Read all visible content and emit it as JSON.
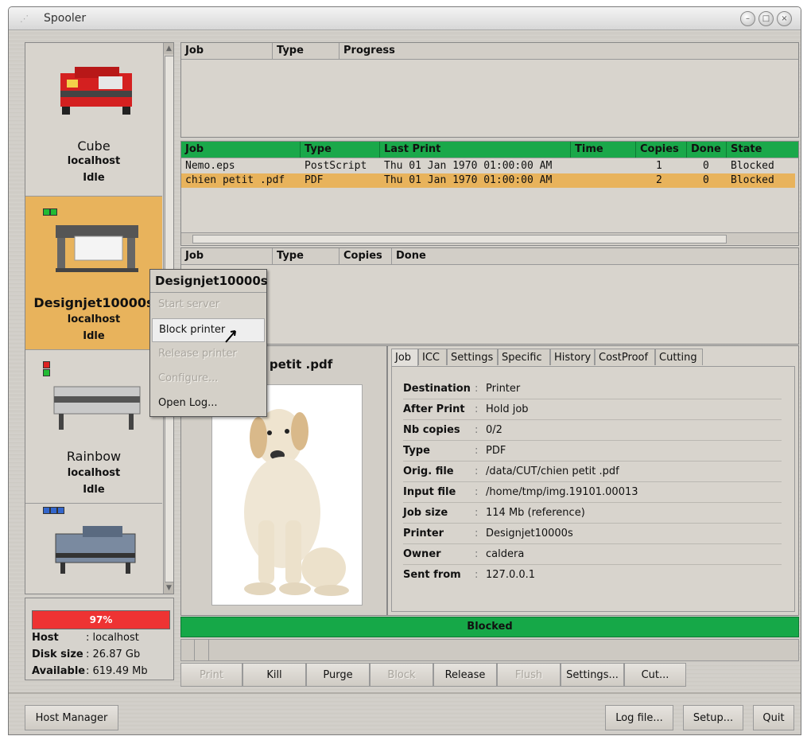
{
  "window": {
    "title": "Spooler"
  },
  "printers": [
    {
      "name": "Cube",
      "host": "localhost",
      "state": "Idle",
      "selected": false
    },
    {
      "name": "Designjet10000s",
      "host": "localhost",
      "state": "Idle",
      "selected": true
    },
    {
      "name": "Rainbow",
      "host": "localhost",
      "state": "Idle",
      "selected": false
    },
    {
      "name": "",
      "host": "",
      "state": "",
      "selected": false
    }
  ],
  "disk": {
    "usage_label": "97%",
    "usage_value": 0.97,
    "rows": [
      {
        "key": "Host",
        "value": "localhost"
      },
      {
        "key": "Disk size",
        "value": "26.87 Gb"
      },
      {
        "key": "Available",
        "value": "619.49 Mb"
      }
    ]
  },
  "active_jobs": {
    "columns": [
      "Job",
      "Type",
      "Progress"
    ]
  },
  "queue": {
    "columns": [
      "Job",
      "Type",
      "Last Print",
      "Time",
      "Copies",
      "Done",
      "State"
    ],
    "rows": [
      {
        "job": "Nemo.eps",
        "type": "PostScript",
        "last_print": "Thu 01 Jan 1970 01:00:00 AM",
        "time": "",
        "copies": "1",
        "done": "0",
        "state": "Blocked",
        "selected": false
      },
      {
        "job": "chien petit .pdf",
        "type": "PDF",
        "last_print": "Thu 01 Jan 1970 01:00:00 AM",
        "time": "",
        "copies": "2",
        "done": "0",
        "state": "Blocked",
        "selected": true
      }
    ]
  },
  "history": {
    "columns": [
      "Job",
      "Type",
      "Copies",
      "Done"
    ]
  },
  "context_menu": {
    "title": "Designjet10000s",
    "items": [
      {
        "label": "Start server",
        "enabled": false
      },
      {
        "label": "Block printer",
        "enabled": true,
        "hover": true
      },
      {
        "label": "Release printer",
        "enabled": false
      },
      {
        "label": "Configure...",
        "enabled": false
      },
      {
        "label": "Open Log...",
        "enabled": true
      }
    ]
  },
  "preview": {
    "filename": "n petit .pdf"
  },
  "tabs": [
    "Job",
    "ICC",
    "Settings",
    "Specific",
    "History",
    "CostProof",
    "Cutting"
  ],
  "job_props": [
    {
      "key": "Destination",
      "value": "Printer"
    },
    {
      "key": "After Print",
      "value": "Hold job"
    },
    {
      "key": "Nb copies",
      "value": "0/2"
    },
    {
      "key": "Type",
      "value": "PDF"
    },
    {
      "key": "Orig. file",
      "value": "/data/CUT/chien petit .pdf"
    },
    {
      "key": "Input file",
      "value": "/home/tmp/img.19101.00013"
    },
    {
      "key": "Job size",
      "value": "114 Mb (reference)"
    },
    {
      "key": "Printer",
      "value": "Designjet10000s"
    },
    {
      "key": "Owner",
      "value": "caldera"
    },
    {
      "key": "Sent from",
      "value": "127.0.0.1"
    }
  ],
  "status": {
    "text": "Blocked"
  },
  "actions": [
    {
      "label": "Print",
      "enabled": false
    },
    {
      "label": "Kill",
      "enabled": true
    },
    {
      "label": "Purge",
      "enabled": true
    },
    {
      "label": "Block",
      "enabled": false
    },
    {
      "label": "Release",
      "enabled": true
    },
    {
      "label": "Flush",
      "enabled": false
    },
    {
      "label": "Settings...",
      "enabled": true
    },
    {
      "label": "Cut...",
      "enabled": true
    }
  ],
  "footer": {
    "host_manager": "Host Manager",
    "log_file": "Log file...",
    "setup": "Setup...",
    "quit": "Quit"
  },
  "colors": {
    "selected_row": "#e8b35c",
    "header_green": "#1aa84a",
    "disk_bar": "#ee3333"
  }
}
